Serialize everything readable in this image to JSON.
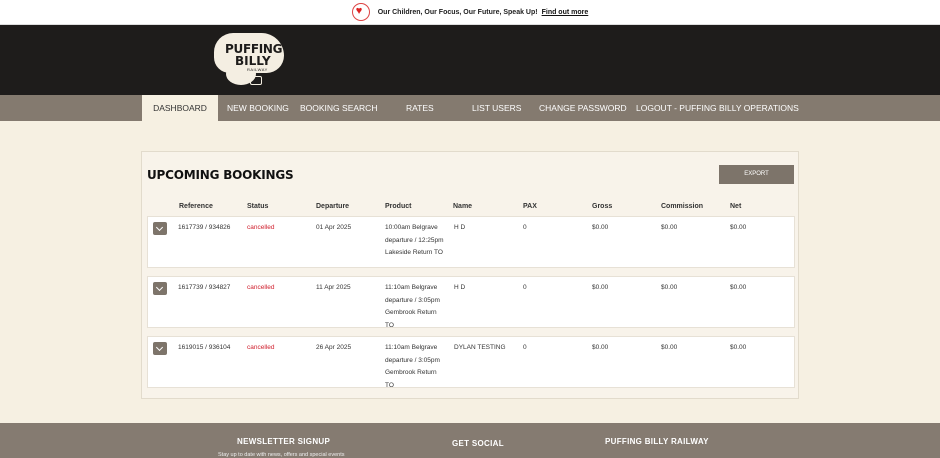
{
  "announcement": {
    "text": "Our Children, Our Focus, Our Future, Speak Up!",
    "link": "Find out more",
    "icon": "heart-badge-icon"
  },
  "logo": {
    "line1": "PUFFING",
    "line2": "BILLY",
    "line3": "RAILWAY"
  },
  "nav": {
    "items": [
      {
        "label": "DASHBOARD"
      },
      {
        "label": "NEW BOOKING"
      },
      {
        "label": "BOOKING SEARCH"
      },
      {
        "label": "RATES"
      },
      {
        "label": "LIST USERS"
      },
      {
        "label": "CHANGE PASSWORD"
      },
      {
        "label": "LOGOUT - PUFFING BILLY OPERATIONS"
      }
    ]
  },
  "bookings": {
    "title": "UPCOMING BOOKINGS",
    "export_label": "EXPORT",
    "columns": [
      "Reference",
      "Status",
      "Departure",
      "Product",
      "Name",
      "PAX",
      "Gross",
      "Commission",
      "Net"
    ],
    "rows": [
      {
        "reference": "1617739 / 934826",
        "status": "cancelled",
        "departure": "01 Apr 2025",
        "product": "10:00am Belgrave departure / 12:25pm Lakeside Return TO",
        "name": "H D",
        "pax": "0",
        "gross": "$0.00",
        "commission": "$0.00",
        "net": "$0.00"
      },
      {
        "reference": "1617739 / 934827",
        "status": "cancelled",
        "departure": "11 Apr 2025",
        "product": "11:10am Belgrave departure / 3:05pm Gembrook Return TO",
        "name": "H D",
        "pax": "0",
        "gross": "$0.00",
        "commission": "$0.00",
        "net": "$0.00"
      },
      {
        "reference": "1619015 / 936104",
        "status": "cancelled",
        "departure": "26 Apr 2025",
        "product": "11:10am Belgrave departure / 3:05pm Gembrook Return TO",
        "name": "DYLAN TESTING",
        "pax": "0",
        "gross": "$0.00",
        "commission": "$0.00",
        "net": "$0.00"
      }
    ]
  },
  "footer": {
    "newsletter": "NEWSLETTER SIGNUP",
    "newsletter_sub": "Stay up to date with news, offers and special events",
    "social": "GET SOCIAL",
    "railway": "PUFFING BILLY RAILWAY"
  },
  "colors": {
    "header": "#1e1c1b",
    "nav": "#847a6f",
    "page": "#f6f0e2",
    "status": "#d0202e"
  }
}
